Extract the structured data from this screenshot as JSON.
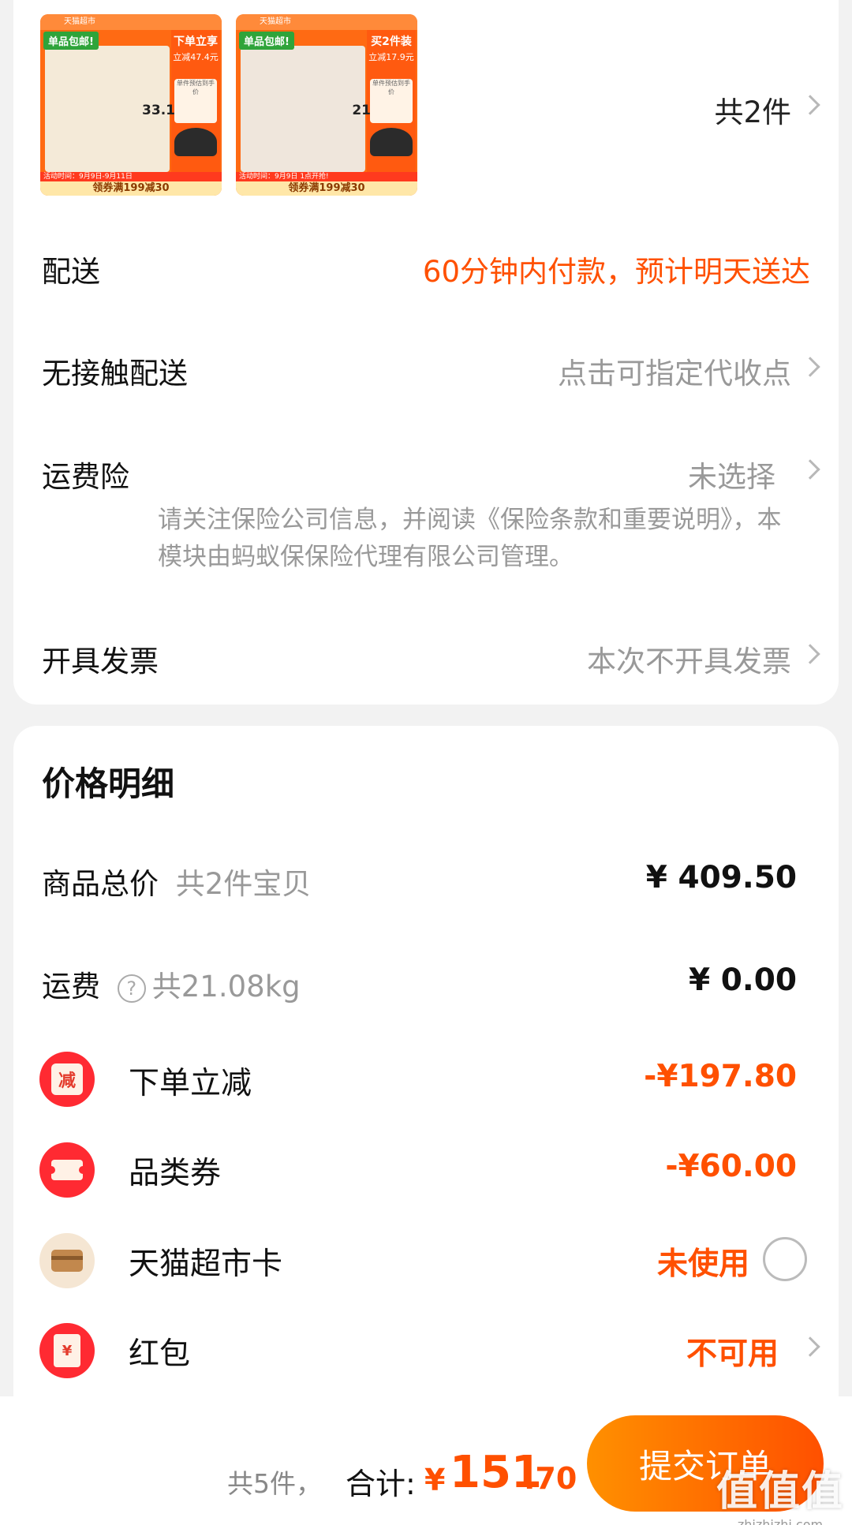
{
  "products": [
    {
      "topbar": "天猫超市",
      "tag": "单品包邮!",
      "promo_title": "下单立享",
      "promo_sub": "立减47.4元",
      "price_label": "单件预估到手价",
      "price": "33.1",
      "activity": "活动时间：9月9日-9月11日",
      "coupon": "领券满199减30"
    },
    {
      "topbar": "天猫超市",
      "tag": "单品包邮!",
      "promo_title": "买2件装",
      "promo_sub": "立减17.9元",
      "price_label": "单件预估到手价",
      "price": "21",
      "activity": "活动时间：9月9日 1点开抢!",
      "coupon": "领券满199减30"
    }
  ],
  "order": {
    "item_count": "共2件",
    "delivery_label": "配送",
    "delivery_value": "60分钟内付款，预计明天送达",
    "contactless_label": "无接触配送",
    "contactless_value": "点击可指定代收点",
    "insurance_label": "运费险",
    "insurance_value": "未选择",
    "insurance_note": "请关注保险公司信息，并阅读《保险条款和重要说明》，本模块由蚂蚁保保险代理有限公司管理。",
    "invoice_label": "开具发票",
    "invoice_value": "本次不开具发票"
  },
  "price_detail": {
    "title": "价格明细",
    "goods_total_label": "商品总价",
    "goods_total_sub": "共2件宝贝",
    "goods_total_value": "¥ 409.50",
    "shipping_label": "运费",
    "shipping_sub": "共21.08kg",
    "shipping_value": "¥ 0.00",
    "items": [
      {
        "label": "下单立减",
        "value": "-¥197.80",
        "icon": "discount-icon",
        "icon_text": "减"
      },
      {
        "label": "品类券",
        "value": "-¥60.00",
        "icon": "coupon-icon"
      },
      {
        "label": "天猫超市卡",
        "value": "未使用",
        "icon": "card-icon"
      },
      {
        "label": "红包",
        "value": "不可用",
        "icon": "red-packet-icon",
        "icon_text": "¥"
      }
    ]
  },
  "bottom": {
    "count": "共5件，",
    "total_label": "合计:",
    "currency": "¥",
    "amount_int": "151",
    "amount_dec": ".70",
    "submit": "提交订单"
  },
  "watermark": {
    "main": "值值值",
    "sub": "zhizhizhi.com"
  },
  "colors": {
    "accent": "#ff5000",
    "button_start": "#ff9000",
    "icon_red": "#ff2a32"
  }
}
